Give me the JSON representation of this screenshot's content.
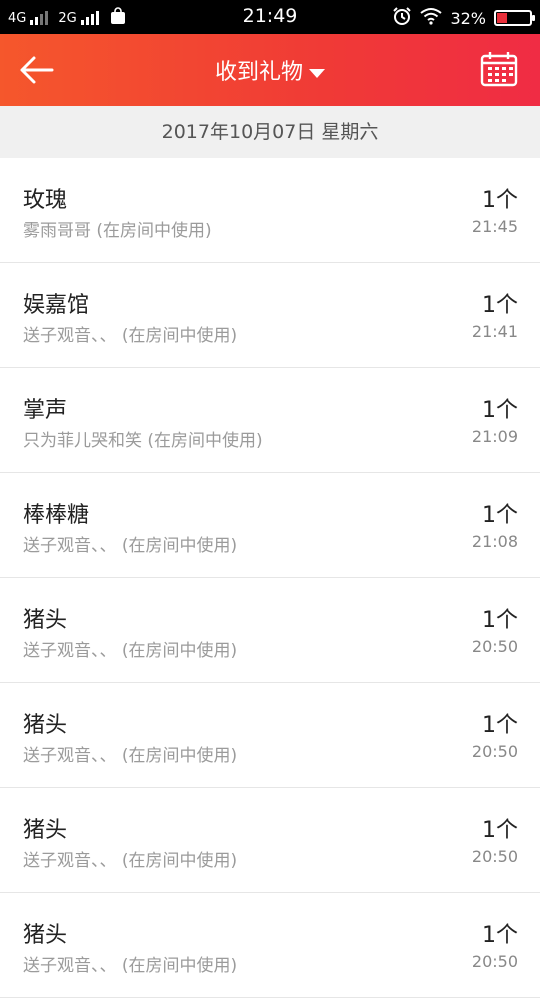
{
  "status_bar": {
    "network_1": "4G",
    "network_2": "2G",
    "time": "21:49",
    "battery": "32%",
    "battery_level": 0.32,
    "icons": [
      "signal-icon",
      "shopping-bag-icon",
      "alarm-icon",
      "wifi-icon",
      "battery-icon"
    ]
  },
  "header": {
    "title": "收到礼物",
    "back_icon": "back-arrow-icon",
    "calendar_icon": "calendar-icon",
    "color_start": "#f5572c",
    "color_end": "#f02c44"
  },
  "date_bar": {
    "label": "2017年10月07日 星期六"
  },
  "gifts": [
    {
      "name": "玫瑰",
      "sender": "雾雨哥哥 (在房间中使用)",
      "count": "1个",
      "time": "21:45"
    },
    {
      "name": "娱嘉馆",
      "sender": "送子观音、、 (在房间中使用)",
      "count": "1个",
      "time": "21:41"
    },
    {
      "name": "掌声",
      "sender": "只为菲儿哭和笑 (在房间中使用)",
      "count": "1个",
      "time": "21:09"
    },
    {
      "name": "棒棒糖",
      "sender": "送子观音、、 (在房间中使用)",
      "count": "1个",
      "time": "21:08"
    },
    {
      "name": "猪头",
      "sender": "送子观音、、 (在房间中使用)",
      "count": "1个",
      "time": "20:50"
    },
    {
      "name": "猪头",
      "sender": "送子观音、、 (在房间中使用)",
      "count": "1个",
      "time": "20:50"
    },
    {
      "name": "猪头",
      "sender": "送子观音、、 (在房间中使用)",
      "count": "1个",
      "time": "20:50"
    },
    {
      "name": "猪头",
      "sender": "送子观音、、 (在房间中使用)",
      "count": "1个",
      "time": "20:50"
    }
  ]
}
